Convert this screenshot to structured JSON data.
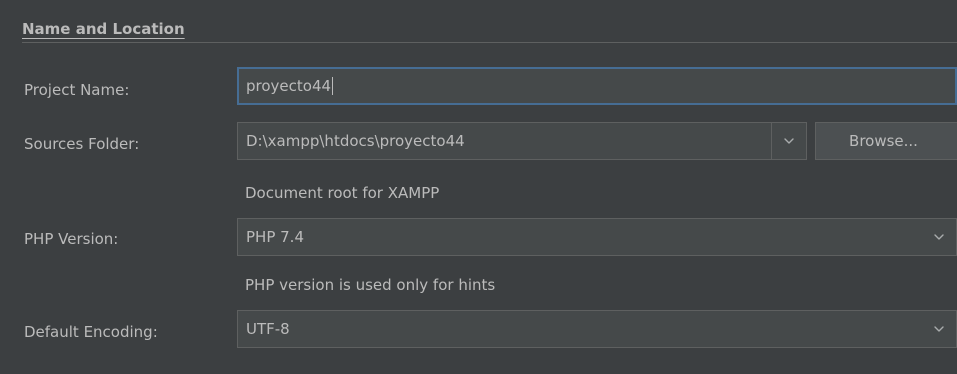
{
  "section": {
    "title": "Name and Location"
  },
  "project_name": {
    "label": "Project Name:",
    "value": "proyecto44"
  },
  "sources_folder": {
    "label": "Sources Folder:",
    "value": "D:\\xampp\\htdocs\\proyecto44",
    "browse_label": "Browse...",
    "hint": "Document root for XAMPP"
  },
  "php_version": {
    "label": "PHP Version:",
    "selected": "PHP 7.4",
    "hint": "PHP version is used only for hints"
  },
  "default_encoding": {
    "label": "Default Encoding:",
    "selected": "UTF-8"
  },
  "icons": {
    "dropdown": "chevron-down-icon"
  },
  "colors": {
    "background": "#3c3f41",
    "field": "#45494a",
    "focus_border": "#466d94",
    "text": "#bbbbbb"
  }
}
